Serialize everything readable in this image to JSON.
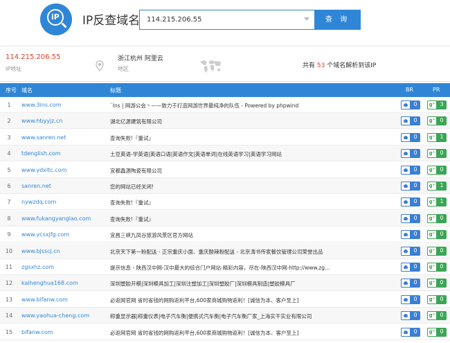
{
  "header": {
    "logo_text": "iP",
    "title": "IP反查域名",
    "search_value": "114.215.206.55",
    "search_button": "查 询"
  },
  "info": {
    "ip": "114.215.206.55",
    "ip_label": "IP地址",
    "location": "浙江杭州 阿里云",
    "location_label": "地区",
    "count_prefix": "共有",
    "count": "53",
    "count_suffix": "个域名解析到该IP"
  },
  "table": {
    "headers": {
      "idx": "序号",
      "domain": "域名",
      "title": "标题",
      "br": "BR",
      "pr": "PR"
    },
    "rows": [
      {
        "idx": "1",
        "domain": "www.3ins.com",
        "title": "`Ins | 网游公会丶——致力于打造网游世界最纯净的队伍 - Powered by phpwind",
        "br": "0",
        "pr": "3"
      },
      {
        "idx": "2",
        "domain": "www.hbyyjz.cn",
        "title": "湖北亿源建筑有限公司",
        "br": "0",
        "pr": "0"
      },
      {
        "idx": "3",
        "domain": "www.sanren.net",
        "title": "查询失败!『重试』",
        "br": "0",
        "pr": "1"
      },
      {
        "idx": "4",
        "domain": "tdenglish.com",
        "title": "土豆英语-学英语|英语口语|英语作文|英语单词|在线英语学习|英语学习网站",
        "br": "0",
        "pr": "0"
      },
      {
        "idx": "5",
        "domain": "www.ydxltc.com",
        "title": "宜都鑫源陶瓷有限公司",
        "br": "0",
        "pr": "0"
      },
      {
        "idx": "6",
        "domain": "sanren.net",
        "title": "您的网站已经关闭!",
        "br": "0",
        "pr": "1"
      },
      {
        "idx": "7",
        "domain": "nywzdq.com",
        "title": "查询失败!『重试』",
        "br": "0",
        "pr": "1"
      },
      {
        "idx": "8",
        "domain": "www.fukangyanglao.com",
        "title": "查询失败!『重试』",
        "br": "0",
        "pr": "0"
      },
      {
        "idx": "9",
        "domain": "www.ycsxjfg.com",
        "title": "宜昌三峡九凤谷旅游风景区官方网站",
        "br": "0",
        "pr": "0"
      },
      {
        "idx": "10",
        "domain": "www.bjsscj.cn",
        "title": "北京天下第一粉配送 - 正宗重庆小面、重庆酸辣粉配送 - 北京涛书传家餐饮管理公司荣誉出品",
        "br": "0",
        "pr": "0"
      },
      {
        "idx": "11",
        "domain": "zgsxhz.com",
        "title": "提示信息 - 陕西汉中网-汉中最大的综合门户网站-精彩内容，尽在-陕西汉中网-http://www.zg...",
        "br": "0",
        "pr": "0"
      },
      {
        "idx": "12",
        "domain": "kaihenghua168.com",
        "title": "深圳塑胶开模|深圳模具加工|深圳注塑加工|深圳塑胶厂|深圳模具制造|塑胶模具厂",
        "br": "0",
        "pr": "0"
      },
      {
        "idx": "13",
        "domain": "www.bifanw.com",
        "title": "必返网官网 省时省钱的网购返利平台,600家商城购物返利！[诚信为本、客户至上]",
        "br": "0",
        "pr": "0"
      },
      {
        "idx": "14",
        "domain": "www.yaohua-cheng.com",
        "title": "称重显示器|称重仪表|电子汽车衡|便携式汽车衡|电子汽车衡厂家_上海实干实业有限公司",
        "br": "0",
        "pr": "0"
      },
      {
        "idx": "15",
        "domain": "bifanw.com",
        "title": "必返网官网 省时省钱的网购返利平台,600家商城购物返利！[诚信为本、客户至上]",
        "br": "0",
        "pr": "0"
      }
    ]
  }
}
